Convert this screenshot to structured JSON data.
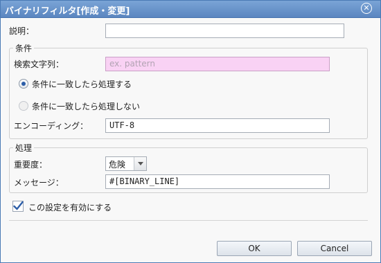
{
  "dialog": {
    "title": "バイナリフィルタ[作成・変更]",
    "close_icon": "close-circle-icon"
  },
  "description": {
    "label": "説明：",
    "value": ""
  },
  "condition": {
    "legend": "条件",
    "search_label": "検索文字列：",
    "search_placeholder": "ex. pattern",
    "search_value": "",
    "radio_match_label": "条件に一致したら処理する",
    "radio_match_selected": true,
    "radio_nomatch_label": "条件に一致したら処理しない",
    "radio_nomatch_selected": false,
    "encoding_label": "エンコーディング：",
    "encoding_value": "UTF-8"
  },
  "processing": {
    "legend": "処理",
    "priority_label": "重要度：",
    "priority_value": "危険",
    "message_label": "メッセージ：",
    "message_value": "#[BINARY_LINE]"
  },
  "enable": {
    "label": "この設定を有効にする",
    "checked": true
  },
  "buttons": {
    "ok": "OK",
    "cancel": "Cancel"
  },
  "colors": {
    "titlebar": "#5b86c0",
    "search_field_bg": "#f9d2f4",
    "check_mark": "#2d5ea8"
  }
}
